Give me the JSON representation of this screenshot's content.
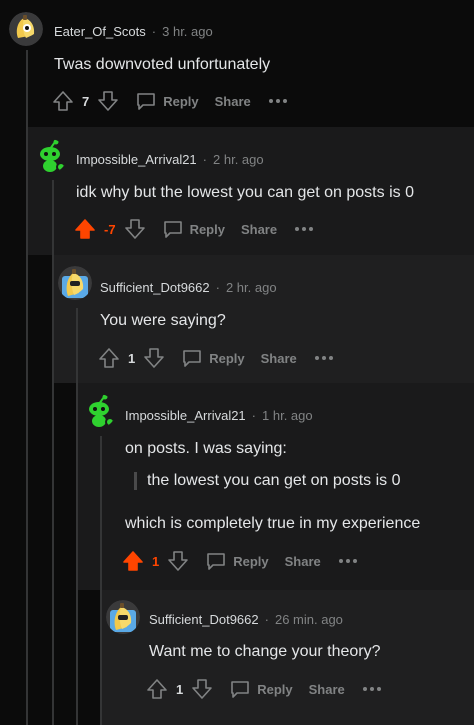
{
  "comments": [
    {
      "username": "Eater_Of_Scots",
      "time": "3 hr. ago",
      "text": "Twas downvoted unfortunately",
      "votes": "7",
      "reply": "Reply",
      "share": "Share"
    },
    {
      "username": "Impossible_Arrival21",
      "time": "2 hr. ago",
      "text": "idk why but the lowest you can get on posts is 0",
      "votes": "-7",
      "reply": "Reply",
      "share": "Share"
    },
    {
      "username": "Sufficient_Dot9662",
      "time": "2 hr. ago",
      "text": "You were saying?",
      "votes": "1",
      "reply": "Reply",
      "share": "Share"
    },
    {
      "username": "Impossible_Arrival21",
      "time": "1 hr. ago",
      "text": "on posts. I was saying:",
      "quote": "the lowest you can get on posts is 0",
      "text2": "which is completely true in my experience",
      "votes": "1",
      "reply": "Reply",
      "share": "Share"
    },
    {
      "username": "Sufficient_Dot9662",
      "time": "26 min. ago",
      "text": "Want me to change your theory?",
      "votes": "1",
      "reply": "Reply",
      "share": "Share"
    }
  ],
  "separator": "·",
  "colors": {
    "upvote_active": "#ff4500",
    "snoo_green": "#2fd12f"
  },
  "icons": [
    "upvote-icon",
    "downvote-icon",
    "comment-icon",
    "more-icon",
    "snoo-avatar",
    "banana-avatar"
  ]
}
